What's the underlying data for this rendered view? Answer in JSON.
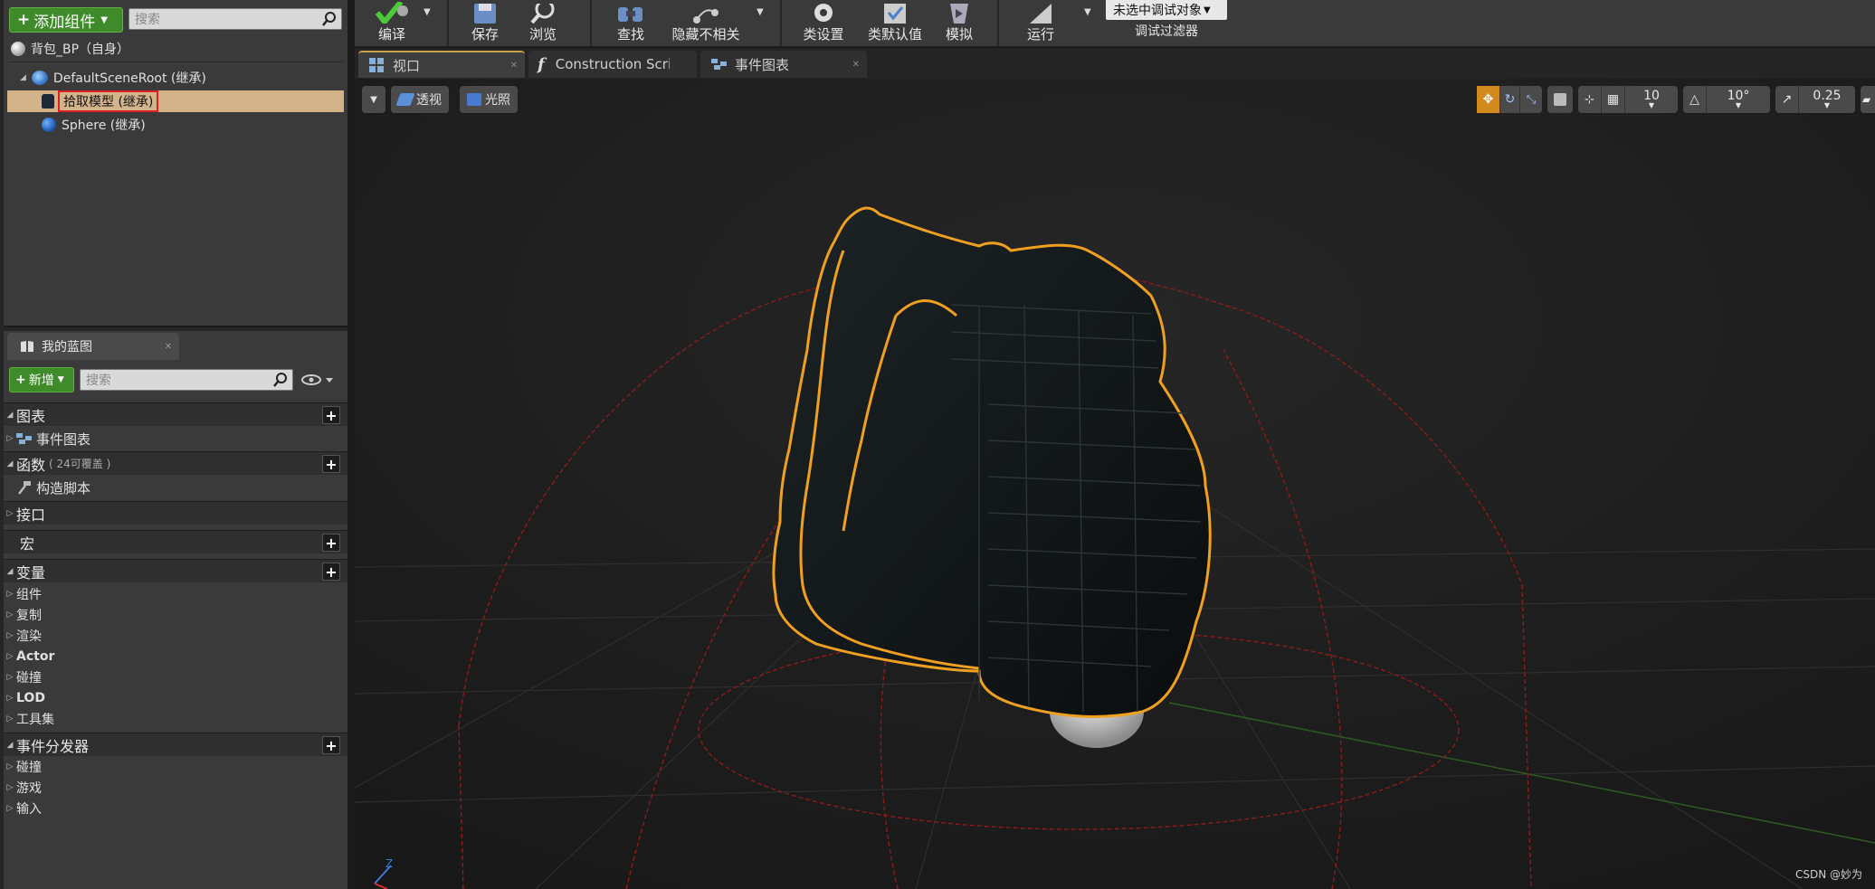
{
  "components": {
    "add_button": "添加组件",
    "search_placeholder": "搜索",
    "self_item": "背包_BP（自身）",
    "tree": [
      {
        "label": "DefaultSceneRoot (继承)"
      },
      {
        "label": "拾取模型 (继承)"
      },
      {
        "label": "Sphere (继承)"
      }
    ]
  },
  "my_blueprint": {
    "tab_label": "我的蓝图",
    "new_button": "新增",
    "search_placeholder": "搜索",
    "sections": {
      "graphs": "图表",
      "event_graph": "事件图表",
      "functions": "函数",
      "functions_note": "( 24可覆盖 )",
      "construction_script": "构造脚本",
      "interfaces": "接口",
      "macros": "宏",
      "variables": "变量",
      "var_groups": [
        "组件",
        "复制",
        "渲染",
        "Actor",
        "碰撞",
        "LOD",
        "工具集"
      ],
      "dispatchers": "事件分发器",
      "dispatcher_groups": [
        "碰撞",
        "游戏",
        "输入"
      ]
    }
  },
  "toolbar": {
    "compile": "编译",
    "save": "保存",
    "browse": "浏览",
    "find": "查找",
    "hide_unrelated": "隐藏不相关",
    "class_settings": "类设置",
    "class_defaults": "类默认值",
    "simulate": "模拟",
    "run": "运行",
    "debug_object": "未选中调试对象",
    "debug_filter": "调试过滤器"
  },
  "tabs": [
    {
      "label": "视口",
      "active": true
    },
    {
      "label": "Construction Scrip",
      "active": false
    },
    {
      "label": "事件图表",
      "active": false
    }
  ],
  "viewport": {
    "perspective": "透视",
    "lit": "光照",
    "grid_snap": "10",
    "rotation_snap": "10°",
    "scale_snap": "0.25",
    "watermark": "CSDN @妙为"
  },
  "colors": {
    "accent_green": "#3f8a2a",
    "selection": "#d3b48a",
    "outline": "#f0a020",
    "snap_active": "#d08a1e"
  }
}
